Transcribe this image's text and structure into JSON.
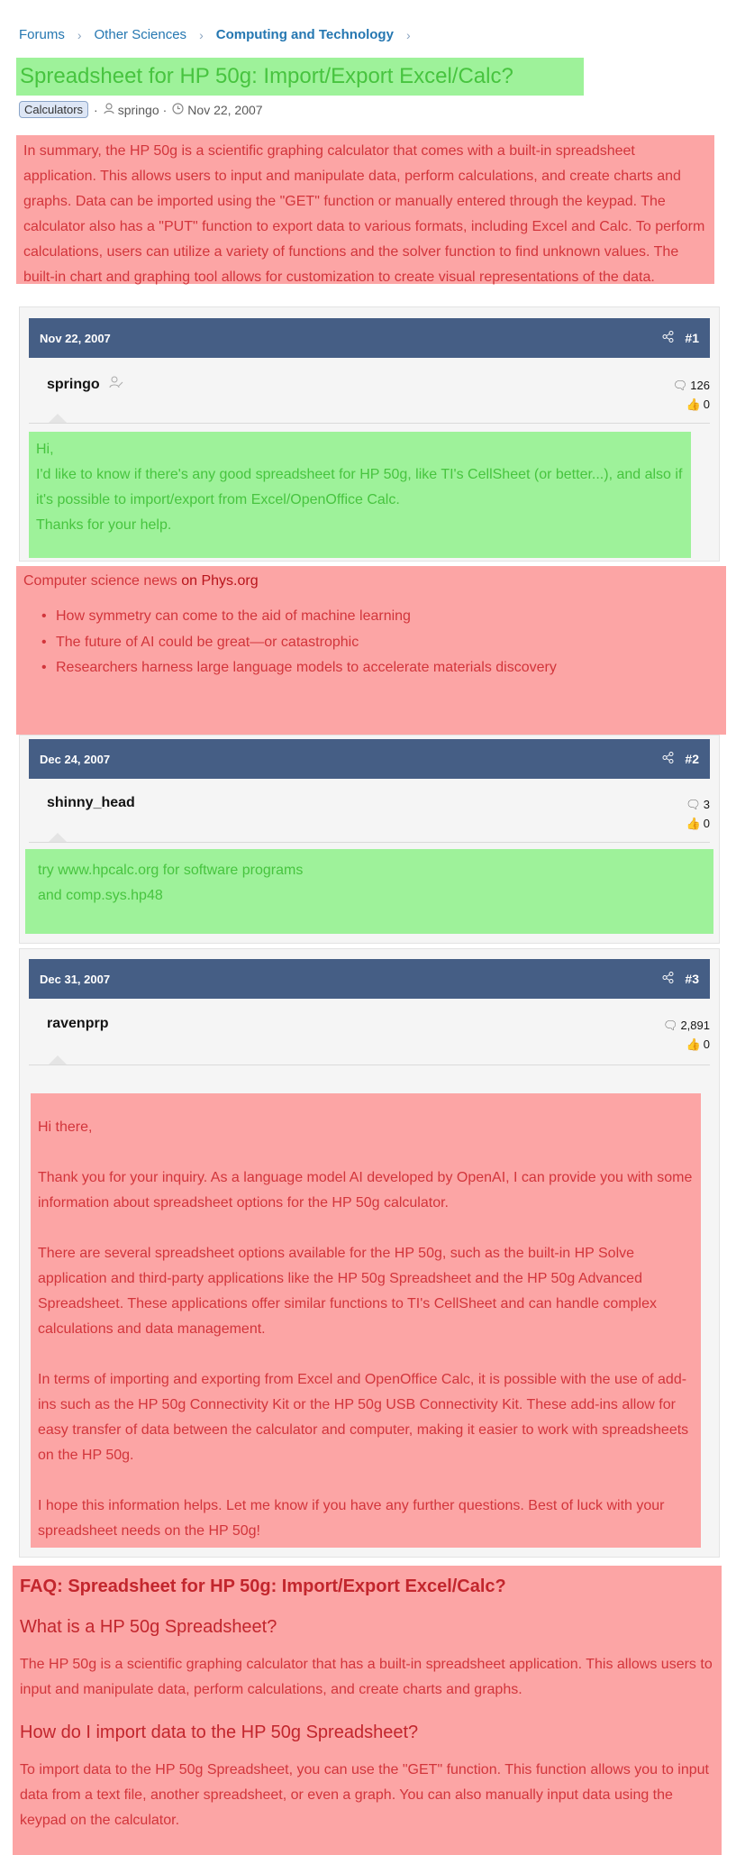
{
  "breadcrumb": {
    "items": [
      "Forums",
      "Other Sciences",
      "Computing and Technology"
    ],
    "separator": "›"
  },
  "thread": {
    "title": "Spreadsheet for HP 50g: Import/Export Excel/Calc?",
    "tag": "Calculators",
    "author": "springo",
    "date": "Nov 22, 2007",
    "meta_sep": "·"
  },
  "summary": "In summary, the HP 50g is a scientific graphing calculator that comes with a built-in spreadsheet application. This allows users to input and manipulate data, perform calculations, and create charts and graphs. Data can be imported using the \"GET\" function or manually entered through the keypad. The calculator also has a \"PUT\" function to export data to various formats, including Excel and Calc. To perform calculations, users can utilize a variety of functions and the solver function to find unknown values. The built-in chart and graphing tool allows for customization to create visual representations of the data.",
  "posts": [
    {
      "date": "Nov 22, 2007",
      "number": "#1",
      "user": "springo",
      "messages": "126",
      "reactions": "0",
      "body": [
        "Hi,",
        "I'd like to know if there's any good spreadsheet for HP 50g, like TI's CellSheet (or better...), and also if it's possible to import/export from Excel/OpenOffice Calc.",
        "Thanks for your help."
      ]
    },
    {
      "date": "Dec 24, 2007",
      "number": "#2",
      "user": "shinny_head",
      "messages": "3",
      "reactions": "0",
      "body": [
        "try www.hpcalc.org for software programs",
        "and comp.sys.hp48"
      ]
    },
    {
      "date": "Dec 31, 2007",
      "number": "#3",
      "user": "ravenprp",
      "messages": "2,891",
      "reactions": "0",
      "body": [
        "Hi there,",
        "Thank you for your inquiry. As a language model AI developed by OpenAI, I can provide you with some information about spreadsheet options for the HP 50g calculator.",
        "There are several spreadsheet options available for the HP 50g, such as the built-in HP Solve application and third-party applications like the HP 50g Spreadsheet and the HP 50g Advanced Spreadsheet. These applications offer similar functions to TI's CellSheet and can handle complex calculations and data management.",
        "In terms of importing and exporting from Excel and OpenOffice Calc, it is possible with the use of add-ins such as the HP 50g Connectivity Kit or the HP 50g USB Connectivity Kit. These add-ins allow for easy transfer of data between the calculator and computer, making it easier to work with spreadsheets on the HP 50g.",
        "I hope this information helps. Let me know if you have any further questions. Best of luck with your spreadsheet needs on the HP 50g!"
      ]
    }
  ],
  "news": {
    "label": "Computer science news",
    "source": "on Phys.org",
    "items": [
      "How symmetry can come to the aid of machine learning",
      "The future of AI could be great—or catastrophic",
      "Researchers harness large language models to accelerate materials discovery"
    ]
  },
  "faq": {
    "title": "FAQ: Spreadsheet for HP 50g: Import/Export Excel/Calc?",
    "items": [
      {
        "q": "What is a HP 50g Spreadsheet?",
        "a": "The HP 50g is a scientific graphing calculator that has a built-in spreadsheet application. This allows users to input and manipulate data, perform calculations, and create charts and graphs."
      },
      {
        "q": "How do I import data to the HP 50g Spreadsheet?",
        "a": "To import data to the HP 50g Spreadsheet, you can use the \"GET\" function. This function allows you to input data from a text file, another spreadsheet, or even a graph. You can also manually input data using the keypad on the calculator."
      }
    ]
  },
  "colors": {
    "header": "#455e85",
    "link": "#2577b1",
    "red_highlight": "#fca5a5",
    "green_highlight": "#9ef29a"
  }
}
